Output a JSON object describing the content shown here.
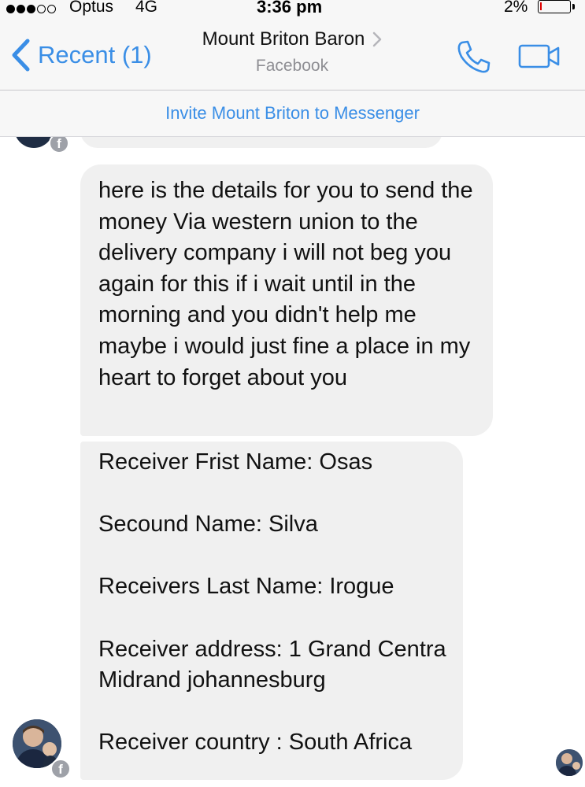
{
  "status_bar": {
    "carrier": "Optus",
    "network": "4G",
    "time": "3:36 pm",
    "battery": "2%",
    "signal_strength": 3,
    "signal_max": 5,
    "battery_level": 0.02
  },
  "header": {
    "back_label": "Recent (1)",
    "title": "Mount Briton Baron",
    "subtitle": "Facebook",
    "back_icon": "chevron-left-icon",
    "title_chevron_icon": "chevron-right-icon",
    "call_icon": "phone-icon",
    "video_icon": "video-camera-icon",
    "accent_color": "#3a8ee6"
  },
  "banner": {
    "invite_text": "Invite Mount Briton to Messenger"
  },
  "messages": [
    {
      "sender": "other",
      "text": "here is the details for you to send the money Via western union to the delivery company i will not beg you again for this if i wait until in the morning and you didn't help me maybe i would just fine a place in my heart to forget about you"
    },
    {
      "sender": "other",
      "text": "Receiver Frist Name: Osas\n\nSecound Name: Silva\n\nReceivers Last Name: Irogue\n\nReceiver address: 1 Grand Centra Midrand johannesburg\n\nReceiver country : South Africa"
    }
  ],
  "badges": {
    "facebook_icon": "facebook-icon",
    "facebook_glyph": "f"
  },
  "colors": {
    "bubble_bg": "#f0f0f0",
    "bar_bg": "#f7f7f7",
    "link": "#3a8ee6",
    "subtitle": "#8e8e93"
  }
}
